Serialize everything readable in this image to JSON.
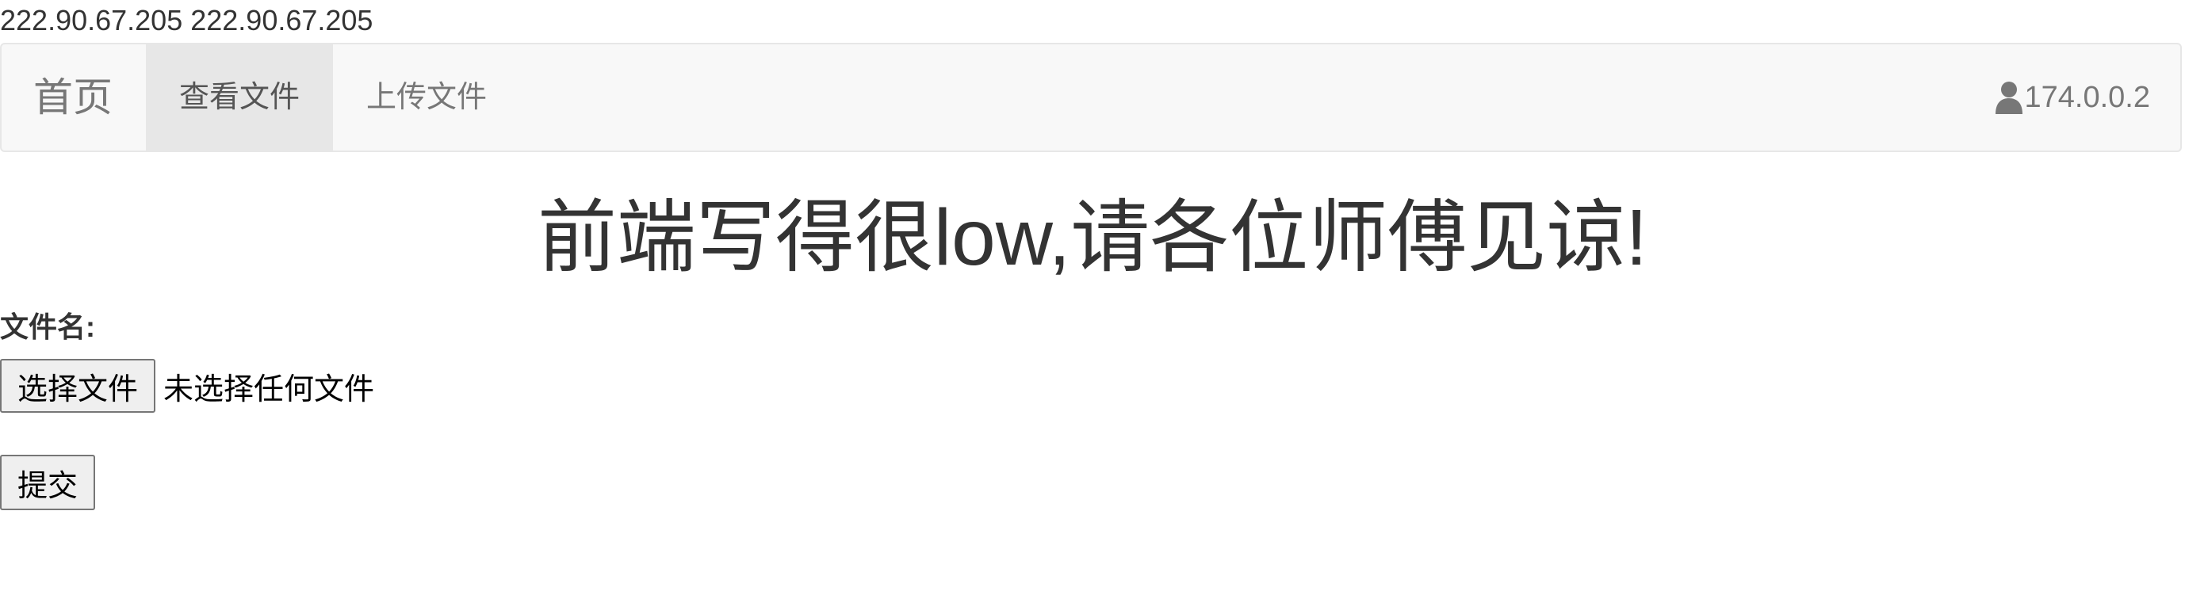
{
  "ip_line": {
    "first": "222.90.67.205",
    "second": "222.90.67.205"
  },
  "navbar": {
    "brand": "首页",
    "items": [
      {
        "label": "查看文件",
        "active": true
      },
      {
        "label": "上传文件",
        "active": false
      }
    ],
    "user": {
      "icon": "user-icon",
      "label": "174.0.0.2"
    }
  },
  "main": {
    "heading": "前端写得很low,请各位师傅见谅!",
    "form": {
      "file_label": "文件名:",
      "choose_button": "选择文件",
      "no_file_text": "未选择任何文件",
      "submit_button": "提交"
    }
  },
  "colors": {
    "navbar_bg": "#f8f8f8",
    "navbar_border": "#e7e7e7",
    "active_tab_bg": "#e7e7e7",
    "nav_text": "#777777",
    "body_text": "#333333"
  }
}
